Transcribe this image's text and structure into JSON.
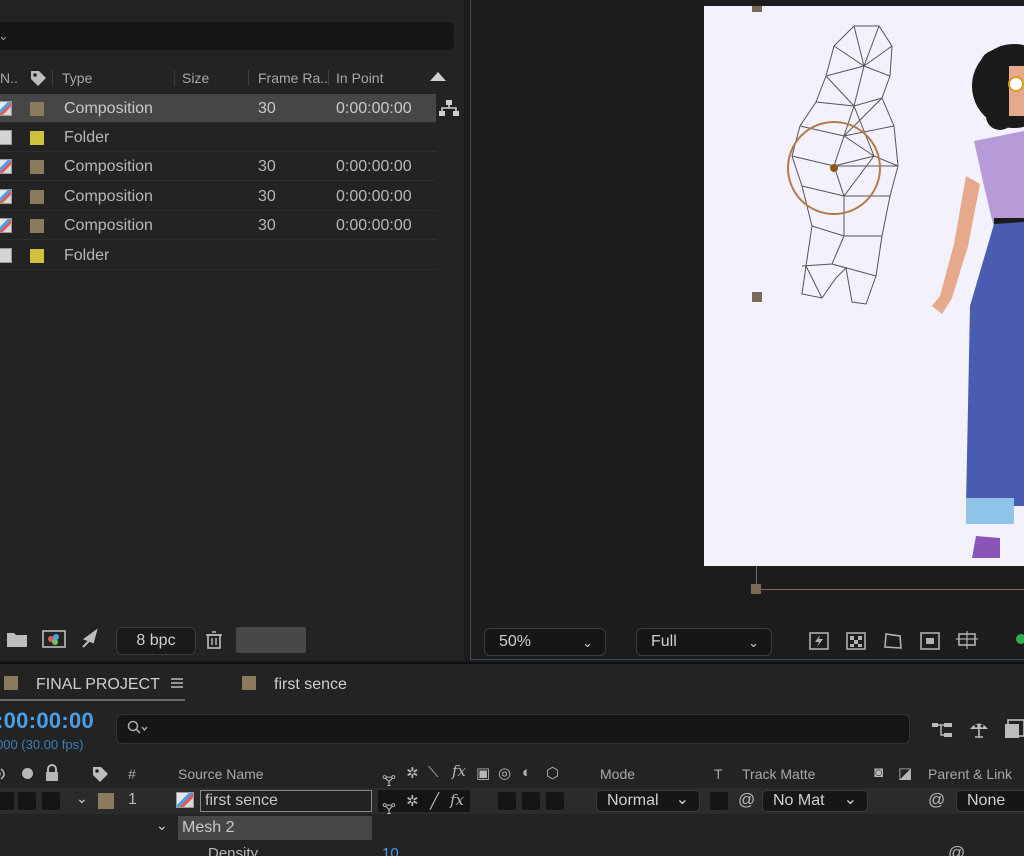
{
  "project_panel": {
    "columns": [
      "N..",
      "Type",
      "Size",
      "Frame Ra..",
      "In Point"
    ],
    "items": [
      {
        "type": "Composition",
        "frame_rate": "30",
        "in_point": "0:00:00:00",
        "kind": "comp",
        "label_color": "#8c7a5c",
        "selected": true
      },
      {
        "type": "Folder",
        "frame_rate": "",
        "in_point": "",
        "kind": "folder",
        "label_color": "#cfc23a",
        "selected": false
      },
      {
        "type": "Composition",
        "frame_rate": "30",
        "in_point": "0:00:00:00",
        "kind": "comp",
        "label_color": "#8c7a5c",
        "selected": false
      },
      {
        "type": "Composition",
        "frame_rate": "30",
        "in_point": "0:00:00:00",
        "kind": "comp",
        "label_color": "#8c7a5c",
        "selected": false
      },
      {
        "type": "Composition",
        "frame_rate": "30",
        "in_point": "0:00:00:00",
        "kind": "comp",
        "label_color": "#8c7a5c",
        "selected": false
      },
      {
        "type": "Folder",
        "frame_rate": "",
        "in_point": "",
        "kind": "folder",
        "label_color": "#cfc23a",
        "selected": false
      }
    ],
    "footer": {
      "bpc": "8 bpc"
    }
  },
  "viewer": {
    "zoom": "50%",
    "resolution": "Full"
  },
  "timeline": {
    "tabs": [
      {
        "label": "FINAL PROJECT",
        "color": "#8c7a5c"
      },
      {
        "label": "first sence",
        "color": "#8c7a5c"
      }
    ],
    "timecode": ":00:00:00",
    "fps": "000 (30.00 fps)",
    "headers": {
      "number": "#",
      "source_name": "Source Name",
      "mode": "Mode",
      "t": "T",
      "track_matte": "Track Matte",
      "parent_link": "Parent & Link"
    },
    "layer": {
      "index": "1",
      "name": "first sence",
      "mode": "Normal",
      "track_matte": "No Mat",
      "parent": "None"
    },
    "effect": {
      "name": "Mesh 2"
    },
    "property": {
      "name": "Density",
      "value": "10"
    }
  },
  "colors": {
    "accent": "#4a9fe8",
    "panel": "#232323",
    "canvas": "#f3f1fb"
  }
}
